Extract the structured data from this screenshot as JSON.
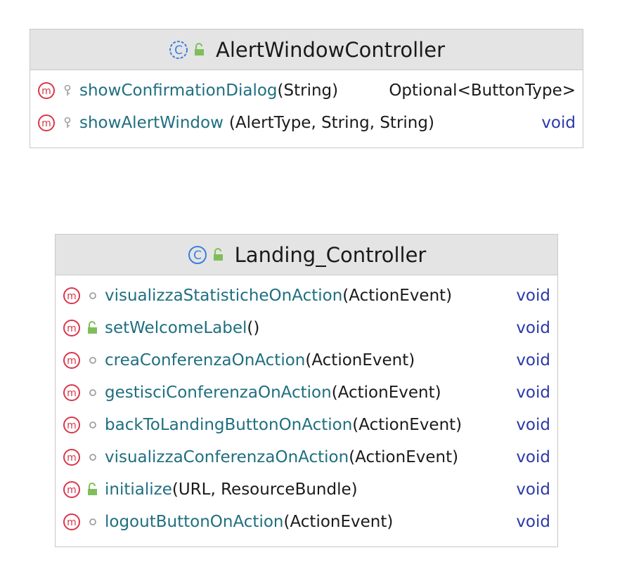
{
  "colors": {
    "method_icon": "#d9364a",
    "class_icon": "#3a7fe0",
    "public_lock": "#7fbf5a",
    "package_dot": "#a0a0a0",
    "method_name": "#1f6f7f",
    "return_type": "#2b39a8",
    "header_bg": "#e4e4e4"
  },
  "classes": [
    {
      "name": "AlertWindowController",
      "class_icon": "class-icon",
      "visibility_icon": "public-lock-icon",
      "methods": [
        {
          "icon": "method-icon",
          "visibility": "private-key-icon",
          "name": "showConfirmationDialog",
          "params": "(String)",
          "return_type": "Optional<ButtonType>"
        },
        {
          "icon": "method-icon",
          "visibility": "private-key-icon",
          "name": "showAlertWindow",
          "params": "(AlertType, String, String)",
          "return_type": "void"
        }
      ]
    },
    {
      "name": "Landing_Controller",
      "class_icon": "class-icon",
      "visibility_icon": "public-lock-icon",
      "methods": [
        {
          "icon": "method-icon",
          "visibility": "package-dot-icon",
          "name": "visualizzaStatisticheOnAction",
          "params": "(ActionEvent)",
          "return_type": "void"
        },
        {
          "icon": "method-icon",
          "visibility": "public-lock-icon",
          "name": "setWelcomeLabel",
          "params": "()",
          "return_type": "void"
        },
        {
          "icon": "method-icon",
          "visibility": "package-dot-icon",
          "name": "creaConferenzaOnAction",
          "params": "(ActionEvent)",
          "return_type": "void"
        },
        {
          "icon": "method-icon",
          "visibility": "package-dot-icon",
          "name": "gestisciConferenzaOnAction",
          "params": "(ActionEvent)",
          "return_type": "void"
        },
        {
          "icon": "method-icon",
          "visibility": "package-dot-icon",
          "name": "backToLandingButtonOnAction",
          "params": "(ActionEvent)",
          "return_type": "void"
        },
        {
          "icon": "method-icon",
          "visibility": "package-dot-icon",
          "name": "visualizzaConferenzaOnAction",
          "params": "(ActionEvent)",
          "return_type": "void"
        },
        {
          "icon": "method-icon",
          "visibility": "public-lock-icon",
          "name": "initialize",
          "params": "(URL, ResourceBundle)",
          "return_type": "void"
        },
        {
          "icon": "method-icon",
          "visibility": "package-dot-icon",
          "name": "logoutButtonOnAction",
          "params": "(ActionEvent)",
          "return_type": "void"
        }
      ]
    }
  ]
}
